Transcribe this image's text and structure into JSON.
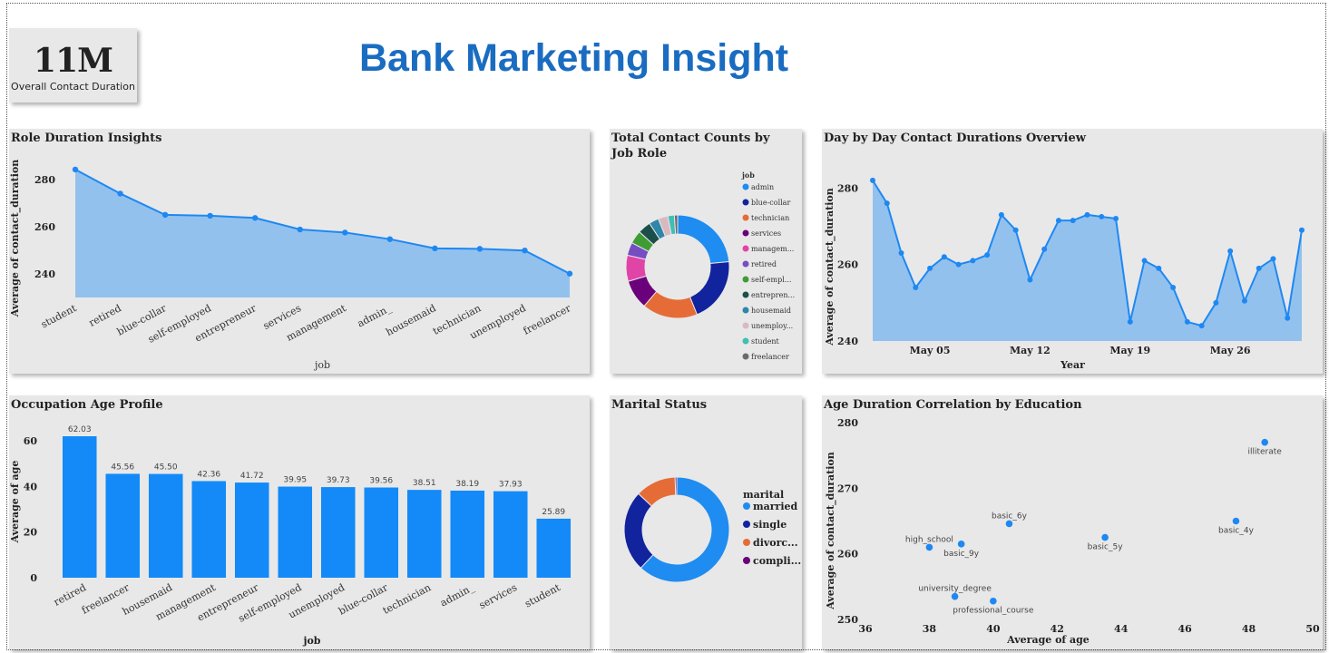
{
  "header": {
    "title": "Bank Marketing Insight",
    "kpi_value": "11M",
    "kpi_label": "Overall Contact Duration"
  },
  "colors": {
    "title_blue": "#1a6cc1",
    "area_fill": "#93c1ee",
    "line_blue": "#1e88f2",
    "bar_blue": "#138af8"
  },
  "chart_data": [
    {
      "id": "role",
      "type": "area",
      "title": "Role Duration Insights",
      "xlabel": "job",
      "ylabel": "Average of contact_duration",
      "categories": [
        "student",
        "retired",
        "blue-collar",
        "self-employed",
        "entrepreneur",
        "services",
        "management",
        "admin.",
        "housemaid",
        "technician",
        "unemployed",
        "freelancer"
      ],
      "category_display": [
        "student",
        "retired",
        "blue-collar",
        "self-employed",
        "entrepreneur",
        "services",
        "management",
        "admin_",
        "housemaid",
        "technician",
        "unemployed",
        "freelancer"
      ],
      "values": [
        284.2,
        274.0,
        265.0,
        264.6,
        263.7,
        258.8,
        257.5,
        254.7,
        250.8,
        250.6,
        249.9,
        240.1
      ],
      "yticks": [
        240,
        260,
        280
      ],
      "ylim": [
        230,
        288
      ]
    },
    {
      "id": "jobdonut",
      "type": "pie",
      "title": "Total Contact Counts by Job Role",
      "legend_title": "job",
      "labels": [
        "admin",
        "blue-collar",
        "technician",
        "services",
        "managem...",
        "retired",
        "self-empl...",
        "entrepren...",
        "housemaid",
        "unemploy...",
        "student",
        "freelancer"
      ],
      "values": [
        23,
        20,
        17,
        9,
        8,
        4,
        4,
        4,
        3,
        3,
        2,
        1
      ],
      "colors": [
        "#1e8cf0",
        "#12239e",
        "#e66c37",
        "#6b007b",
        "#e044a7",
        "#744ec2",
        "#3f9c35",
        "#1b4f4a",
        "#2e86a8",
        "#d9b9c0",
        "#3fbfb5",
        "#6b6b6b"
      ]
    },
    {
      "id": "daily",
      "type": "area",
      "title": "Day by Day Contact Durations Overview",
      "xlabel": "Year",
      "ylabel": "Average of contact_duration",
      "x_start": "2024-05-01",
      "x_end": "2024-05-31",
      "xtick_labels": [
        "May 05",
        "May 12",
        "May 19",
        "May 26"
      ],
      "xtick_days": [
        5,
        12,
        19,
        26
      ],
      "days": [
        1,
        2,
        3,
        4,
        5,
        6,
        7,
        8,
        9,
        10,
        11,
        12,
        13,
        14,
        15,
        16,
        17,
        18,
        19,
        20,
        21,
        22,
        23,
        24,
        25,
        26,
        27,
        28,
        29,
        30,
        31
      ],
      "values": [
        282,
        276,
        263,
        254,
        259,
        262,
        260,
        261,
        262.5,
        273,
        269,
        256,
        264,
        271.5,
        271.5,
        273,
        272.5,
        272,
        245,
        261,
        259,
        254,
        245,
        244,
        250,
        263.5,
        250.5,
        259,
        261.5,
        246,
        269
      ],
      "yticks": [
        240,
        260,
        280
      ],
      "ylim": [
        240,
        286
      ]
    },
    {
      "id": "agebar",
      "type": "bar",
      "title": "Occupation Age Profile",
      "xlabel": "job",
      "ylabel": "Average of age",
      "categories": [
        "retired",
        "freelancer",
        "housemaid",
        "management",
        "entrepreneur",
        "self-employed",
        "unemployed",
        "blue-collar",
        "technician",
        "admin.",
        "services",
        "student"
      ],
      "category_display": [
        "retired",
        "freelancer",
        "housemaid",
        "management",
        "entrepreneur",
        "self-employed",
        "unemployed",
        "blue-collar",
        "technician",
        "admin_",
        "services",
        "student"
      ],
      "values": [
        62.03,
        45.56,
        45.5,
        42.36,
        41.72,
        39.95,
        39.73,
        39.56,
        38.51,
        38.19,
        37.93,
        25.89
      ],
      "labels": [
        "62.03",
        "45.56",
        "45.50",
        "42.36",
        "41.72",
        "39.95",
        "39.73",
        "39.56",
        "38.51",
        "38.19",
        "37.93",
        "25.89"
      ],
      "yticks": [
        0,
        20,
        40,
        60
      ],
      "ylim": [
        0,
        68
      ]
    },
    {
      "id": "marital",
      "type": "pie",
      "title": "Marital Status",
      "legend_title": "marital",
      "labels": [
        "married",
        "single",
        "divorc...",
        "compli..."
      ],
      "values": [
        62,
        25,
        12.5,
        0.5
      ],
      "colors": [
        "#1e8cf0",
        "#12239e",
        "#e66c37",
        "#6b007b"
      ]
    },
    {
      "id": "scatter",
      "type": "scatter",
      "title": "Age Duration Correlation by Education",
      "xlabel": "Average of age",
      "ylabel": "Average of contact_duration",
      "points": [
        {
          "label": "illiterate",
          "x": 48.5,
          "y": 277.0
        },
        {
          "label": "basic_4y",
          "x": 47.6,
          "y": 265.0
        },
        {
          "label": "basic_6y",
          "x": 40.5,
          "y": 264.6
        },
        {
          "label": "basic_5y",
          "x": 43.5,
          "y": 262.5
        },
        {
          "label": "basic_9y",
          "x": 39.0,
          "y": 261.5
        },
        {
          "label": "high_school",
          "x": 38.0,
          "y": 261.0
        },
        {
          "label": "university_degree",
          "x": 38.8,
          "y": 253.5
        },
        {
          "label": "professional_course",
          "x": 40.0,
          "y": 252.8
        }
      ],
      "xticks": [
        36,
        38,
        40,
        42,
        44,
        46,
        48,
        50
      ],
      "yticks": [
        250,
        260,
        270,
        280
      ],
      "xlim": [
        36,
        50
      ],
      "ylim": [
        250,
        280
      ]
    }
  ]
}
